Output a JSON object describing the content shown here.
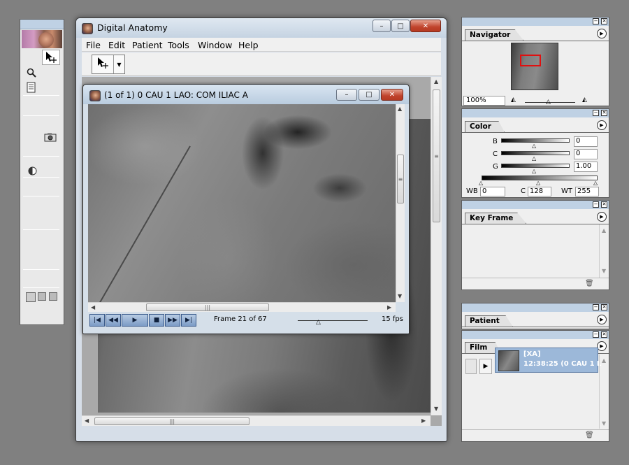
{
  "main_window": {
    "title": "Digital Anatomy",
    "menu": [
      "File",
      "Edit",
      "Patient",
      "Tools",
      "Window",
      "Help"
    ],
    "controls": {
      "minimize": "–",
      "maximize": "□",
      "close": "✕"
    }
  },
  "image_window": {
    "title": "(1 of 1) 0 CAU 1 LAO: COM ILIAC A",
    "frame_text": "Frame 21 of 67",
    "frame_current": 21,
    "frame_total": 67,
    "fps_text": "15 fps",
    "playback_buttons": [
      "|◀",
      "◀◀",
      "▶",
      "■",
      "▶▶",
      "▶|"
    ]
  },
  "navigator": {
    "tab": "Navigator",
    "zoom": "100%"
  },
  "color": {
    "tab": "Color",
    "rows": [
      {
        "label": "B",
        "value": "0"
      },
      {
        "label": "C",
        "value": "0"
      },
      {
        "label": "G",
        "value": "1.00"
      }
    ],
    "wb_label": "WB",
    "wb_value": "0",
    "c_label": "C",
    "c_value": "128",
    "wt_label": "WT",
    "wt_value": "255"
  },
  "key_frame": {
    "tab": "Key Frame"
  },
  "patient": {
    "tab": "Patient"
  },
  "film": {
    "tab": "Film",
    "modality": "[XA]",
    "item_text": "12:38:25 (0 CAU 1 L"
  },
  "icons": {
    "select_tool": "arrow-move-icon",
    "zoom": "magnifier-icon",
    "notes": "document-icon",
    "camera": "camera-icon",
    "contrast": "contrast-icon"
  }
}
